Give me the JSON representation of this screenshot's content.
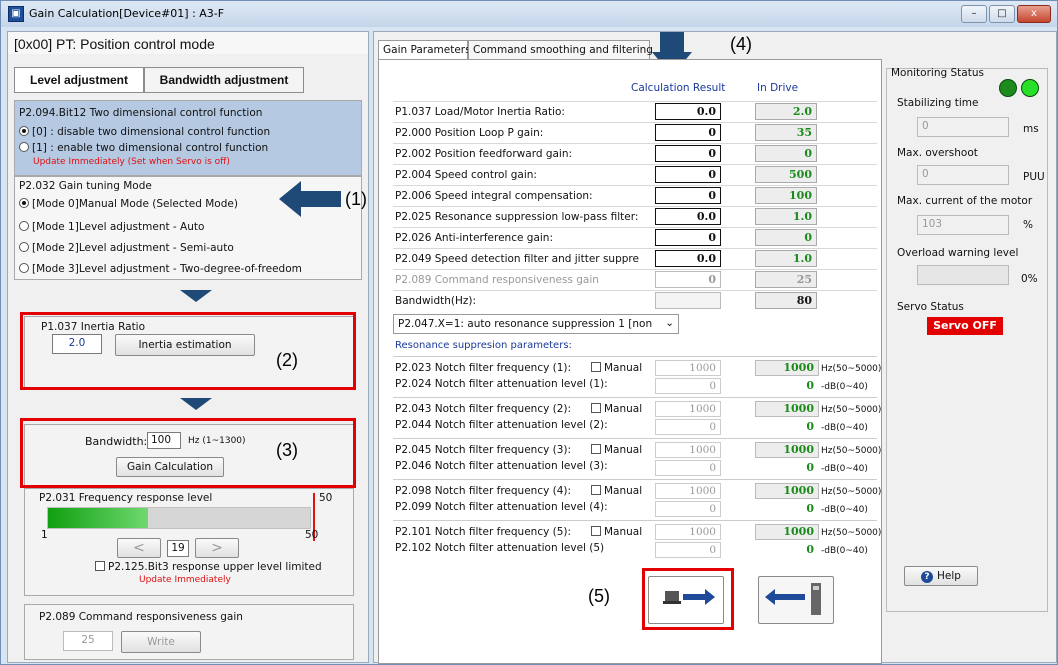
{
  "window": {
    "title": "Gain Calculation[Device#01] : A3-F",
    "minimize": "–",
    "maximize": "□",
    "close": "x"
  },
  "left": {
    "mode_title": "[0x00] PT: Position control mode",
    "tabs": [
      "Level adjustment",
      "Bandwidth adjustment"
    ],
    "two_dim": {
      "title": "P2.094.Bit12 Two dimensional control function",
      "opt0": "[0] : disable two dimensional control function",
      "opt1": "[1] : enable two dimensional control function",
      "note": "Update Immediately (Set when Servo is off)"
    },
    "tuning": {
      "title": "P2.032 Gain tuning Mode",
      "modes": [
        "[Mode 0]Manual Mode  (Selected Mode)",
        "[Mode 1]Level adjustment - Auto",
        "[Mode 2]Level adjustment - Semi-auto",
        "[Mode 3]Level adjustment - Two-degree-of-freedom"
      ]
    },
    "inertia": {
      "title": "P1.037 Inertia Ratio",
      "value": "2.0",
      "button": "Inertia estimation"
    },
    "bandwidth": {
      "label": "Bandwidth:",
      "value": "100",
      "unit": "Hz (1~1300)",
      "button": "Gain Calculation"
    },
    "freq": {
      "title": "P2.031 Frequency response level",
      "max_mark": "50",
      "scale_min": "1",
      "scale_max": "50",
      "value": "19",
      "level": 19,
      "prev": "<",
      "next": ">",
      "upper_limit": "P2.125.Bit3 response upper level limited",
      "note": "Update Immediately"
    },
    "cmd": {
      "title": "P2.089 Command responsiveness gain",
      "value": "25",
      "button": "Write"
    }
  },
  "annotations": {
    "a1": "(1)",
    "a2": "(2)",
    "a3": "(3)",
    "a4": "(4)",
    "a5": "(5)"
  },
  "tabs": [
    "Gain Parameters",
    "Command smoothing and filtering"
  ],
  "params": {
    "col_calc": "Calculation Result",
    "col_drive": "In Drive",
    "rows": [
      {
        "label": "P1.037 Load/Motor Inertia Ratio:",
        "calc": "0.0",
        "drive": "2.0",
        "dim": false
      },
      {
        "label": "P2.000 Position Loop P gain:",
        "calc": "0",
        "drive": "35",
        "dim": false
      },
      {
        "label": "P2.002 Position feedforward gain:",
        "calc": "0",
        "drive": "0",
        "dim": false
      },
      {
        "label": "P2.004 Speed control gain:",
        "calc": "0",
        "drive": "500",
        "dim": false
      },
      {
        "label": "P2.006 Speed integral compensation:",
        "calc": "0",
        "drive": "100",
        "dim": false
      },
      {
        "label": "P2.025 Resonance suppression low-pass filter:",
        "calc": "0.0",
        "drive": "1.0",
        "dim": false
      },
      {
        "label": "P2.026 Anti-interference gain:",
        "calc": "0",
        "drive": "0",
        "dim": false
      },
      {
        "label": "P2.049 Speed detection filter and jitter suppre",
        "calc": "0.0",
        "drive": "1.0",
        "dim": false
      },
      {
        "label": "P2.089 Command responsiveness gain",
        "calc": "0",
        "drive": "25",
        "dim": true
      },
      {
        "label": "Bandwidth(Hz):",
        "calc": "",
        "drive": "80",
        "dim": false
      }
    ],
    "resonance_select": "P2.047.X=1: auto resonance suppression 1 [non",
    "resonance_title": "Resonance suppresion parameters:",
    "notches": [
      {
        "freq_label": "P2.023 Notch filter frequency (1):",
        "att_label": "P2.024 Notch filter attenuation level (1):",
        "freq": "1000",
        "att": "0",
        "freq_drive": "1000",
        "att_drive": "0"
      },
      {
        "freq_label": "P2.043 Notch filter frequency (2):",
        "att_label": "P2.044 Notch filter attenuation level (2):",
        "freq": "1000",
        "att": "0",
        "freq_drive": "1000",
        "att_drive": "0"
      },
      {
        "freq_label": "P2.045 Notch filter frequency (3):",
        "att_label": "P2.046 Notch filter attenuation level (3):",
        "freq": "1000",
        "att": "0",
        "freq_drive": "1000",
        "att_drive": "0"
      },
      {
        "freq_label": "P2.098 Notch filter frequency (4):",
        "att_label": "P2.099 Notch filter attenuation level (4):",
        "freq": "1000",
        "att": "0",
        "freq_drive": "1000",
        "att_drive": "0"
      },
      {
        "freq_label": "P2.101 Notch filter frequency (5):",
        "att_label": "P2.102 Notch filter attenuation level (5)",
        "freq": "1000",
        "att": "0",
        "freq_drive": "1000",
        "att_drive": "0"
      }
    ],
    "manual": "Manual",
    "freq_unit": "Hz(50~5000)",
    "att_unit": "-dB(0~40)"
  },
  "monitor": {
    "title": "Monitoring Status",
    "stab_label": "Stabilizing time",
    "stab_value": "0",
    "stab_unit": "ms",
    "over_label": "Max. overshoot",
    "over_value": "0",
    "over_unit": "PUU",
    "current_label": "Max. current of the motor",
    "current_value": "103",
    "current_unit": "%",
    "overload_label": "Overload warning level",
    "overload_value": "0%",
    "servo_label": "Servo Status",
    "servo_value": "Servo OFF",
    "help": "Help"
  },
  "colors": {
    "red": "#e40000",
    "green": "#1a8a1a",
    "arrow": "#1f4a78"
  }
}
